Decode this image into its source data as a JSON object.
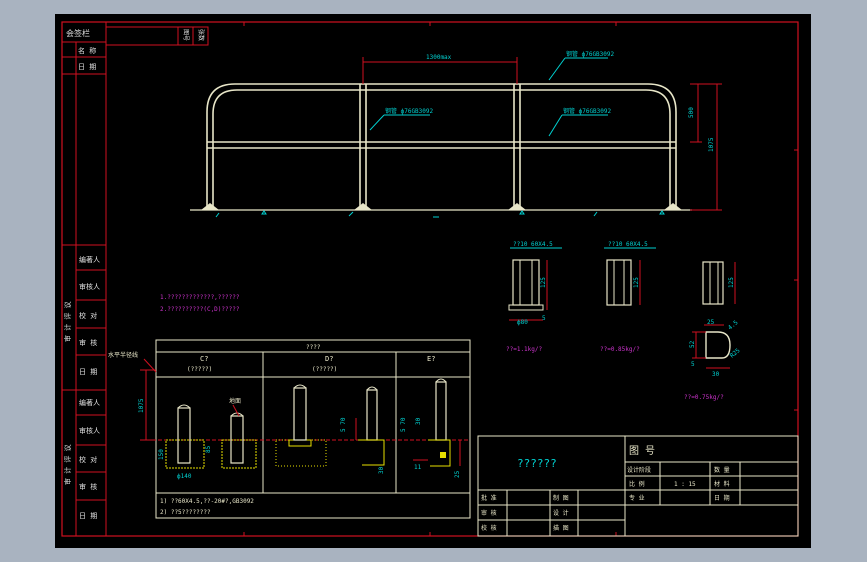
{
  "colors": {
    "background": "#a9b3c0",
    "paper": "#000000",
    "frame": "#d01020",
    "dimension": "#00d0d0",
    "rail": "#e8e6c8",
    "concrete": "#e8e000",
    "note_text": "#cc33cc",
    "title_text": "#e0e0e0"
  },
  "left_strip": {
    "top": {
      "head": "会签栏",
      "rows": [
        "名 称",
        "日 期"
      ]
    },
    "groups": [
      {
        "vertical_label": "审 计 评 议",
        "rows": [
          "编著人",
          "审核人",
          "校 对",
          "审 核",
          "日 期"
        ]
      },
      {
        "vertical_label": "审 计 评 议",
        "rows": [
          "编著人",
          "审核人",
          "校 对",
          "审 核",
          "日 期"
        ]
      }
    ]
  },
  "top_tag": {
    "a": "图号",
    "b": "张数"
  },
  "elevation": {
    "dim_top": "1300max",
    "dim_height": "1075",
    "dim_upper": "500",
    "labels": [
      "钢管 ф76GB3092",
      "钢管 ф76GB3092",
      "钢管 ф76GB3092"
    ]
  },
  "notes": [
    "1.?????????????,??????",
    "2.??????????(C,D)?????"
  ],
  "posts": [
    {
      "title": "??10  60X4.5",
      "dims": [
        "125",
        "5"
      ],
      "base": "ф80",
      "mass": "??=1.1kg/?"
    },
    {
      "title": "??10  60X4.5",
      "dims": [
        "125"
      ],
      "mass": "??=0.85kg/?"
    },
    {
      "title": "",
      "dims": [
        "125"
      ],
      "mass": ""
    }
  ],
  "bracket": {
    "dims": [
      "25",
      "52",
      "5",
      "30",
      "4.5",
      "R25"
    ],
    "mass": "??=0.75kg/?"
  },
  "foundation_table": {
    "title": "????",
    "side_label": "水平半径线",
    "height_dim": "1075",
    "columns": [
      {
        "head": "C?",
        "sub": "(?????)",
        "tags": [
          "地面"
        ],
        "dims": [
          "150",
          "ф140",
          "85"
        ]
      },
      {
        "head": "D?",
        "sub": "(?????)",
        "tags": [],
        "dims": [
          "5 70",
          "30"
        ]
      },
      {
        "head": "E?",
        "sub": "",
        "tags": [],
        "dims": [
          "5 70",
          "30",
          "25",
          "11"
        ]
      }
    ],
    "notes": [
      "1) ??60X4.5,??-20#?,GB3092",
      "2) ??5????????"
    ]
  },
  "title_block": {
    "name": "??????",
    "drawing_no_label": "图 号",
    "design_label": "设计阶段",
    "quantity_label": "数 量",
    "scale_label": "比 例",
    "scale_value": "1 : 15",
    "material_label": "材 料",
    "major_label": "专 业",
    "date_label": "日 期",
    "sign_rows": [
      [
        "批 准",
        "制 图"
      ],
      [
        "审 核",
        "设 计"
      ],
      [
        "校 核",
        "描 图"
      ]
    ]
  }
}
